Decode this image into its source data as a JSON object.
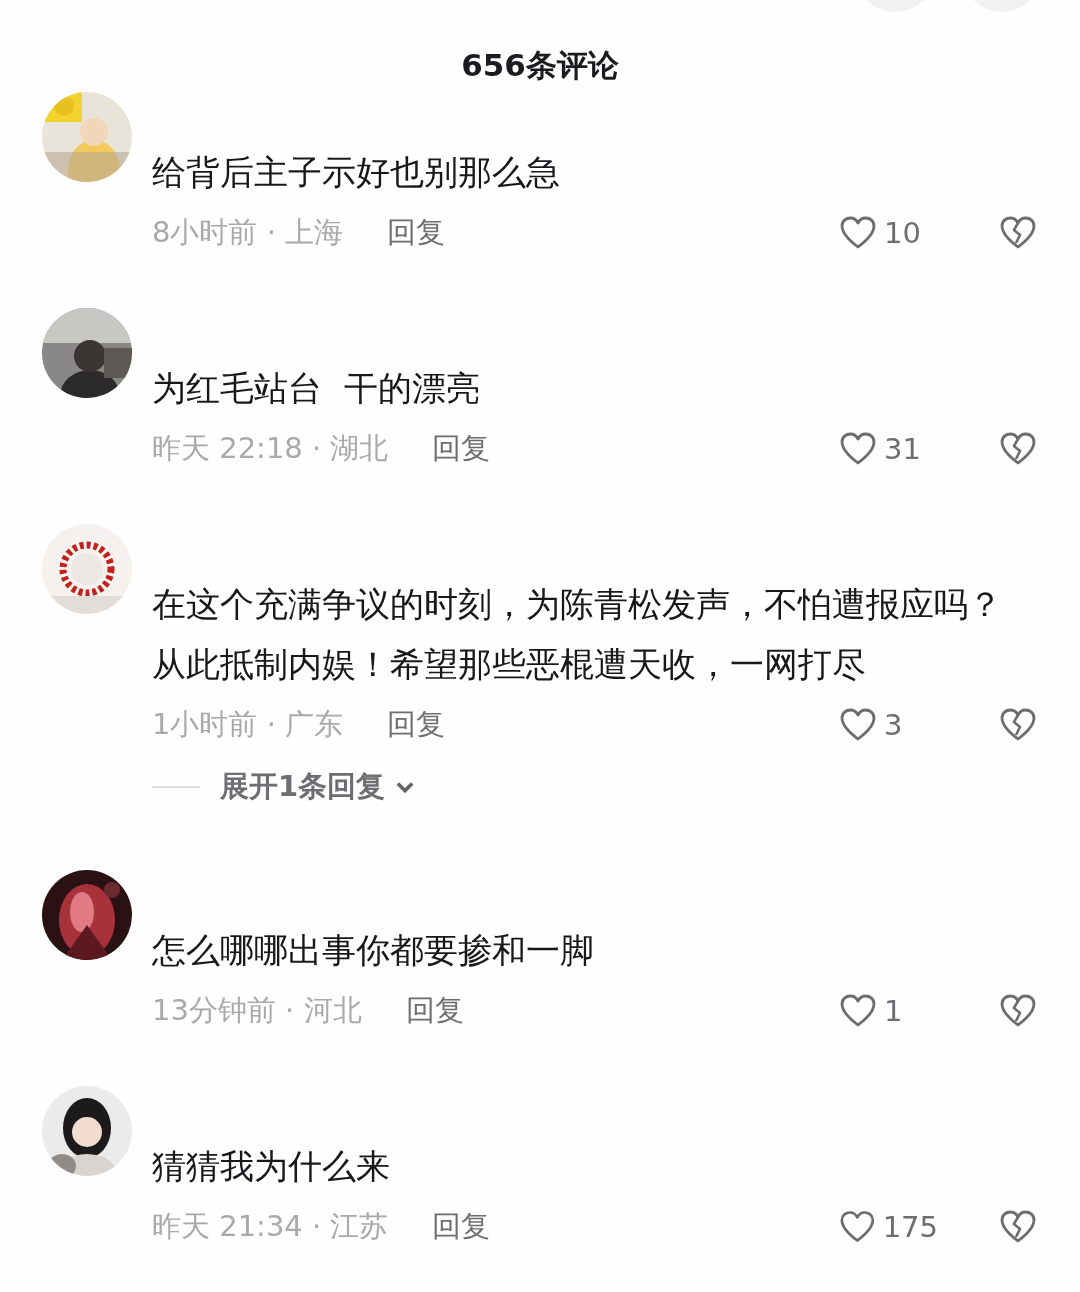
{
  "header": {
    "title": "656条评论"
  },
  "top_buttons": [
    {
      "kind": "round"
    },
    {
      "kind": "round"
    }
  ],
  "comments": [
    {
      "text": "给背后主子示好也别那么急",
      "meta": "8小时前 · 上海",
      "reply": "回复",
      "likes": "10"
    },
    {
      "text": "为红毛站台  干的漂亮",
      "meta": "昨天 22:18 · 湖北",
      "reply": "回复",
      "likes": "31"
    },
    {
      "text": "在这个充满争议的时刻，为陈青松发声，不怕遭报应吗？从此抵制内娱！希望那些恶棍遭天收，一网打尽",
      "meta": "1小时前 · 广东",
      "reply": "回复",
      "likes": "3",
      "expand": "展开1条回复"
    },
    {
      "text": "怎么哪哪出事你都要掺和一脚",
      "meta": "13分钟前 · 河北",
      "reply": "回复",
      "likes": "1"
    },
    {
      "text": "猜猜我为什么来",
      "meta": "昨天 21:34 · 江苏",
      "reply": "回复",
      "likes": "175"
    }
  ]
}
